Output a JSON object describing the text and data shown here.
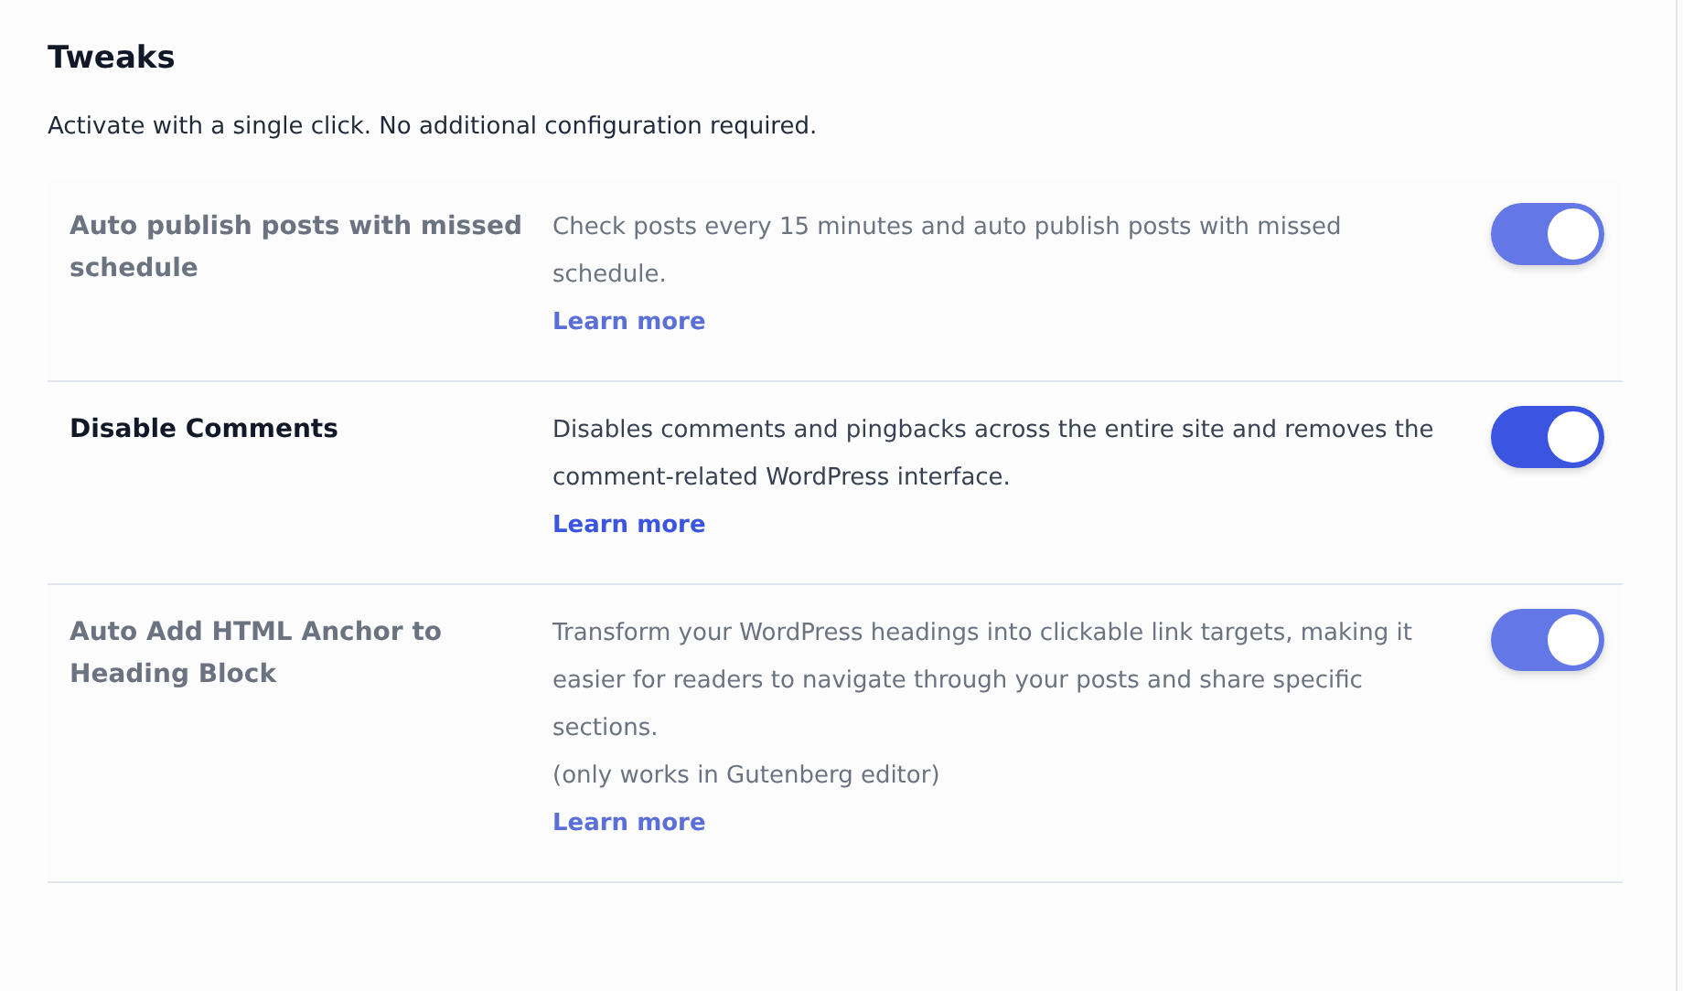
{
  "title": "Tweaks",
  "subtitle": "Activate with a single click. No additional configuration required.",
  "tweaks": [
    {
      "name": "Auto publish posts with missed schedule",
      "description": "Check posts every 15 minutes and auto publish posts with missed schedule.",
      "link": "Learn more",
      "on": true,
      "blurred": true
    },
    {
      "name": "Disable Comments",
      "description": "Disables comments and pingbacks across the entire site and removes the comment-related WordPress interface.",
      "link": "Learn more",
      "on": true,
      "blurred": false
    },
    {
      "name": "Auto Add HTML Anchor to Heading Block",
      "description": "Transform your WordPress headings into clickable link targets, making it easier for readers to navigate through your posts and share specific sections.",
      "note": "(only works in Gutenberg editor)",
      "link": "Learn more",
      "on": true,
      "blurred": true
    }
  ]
}
